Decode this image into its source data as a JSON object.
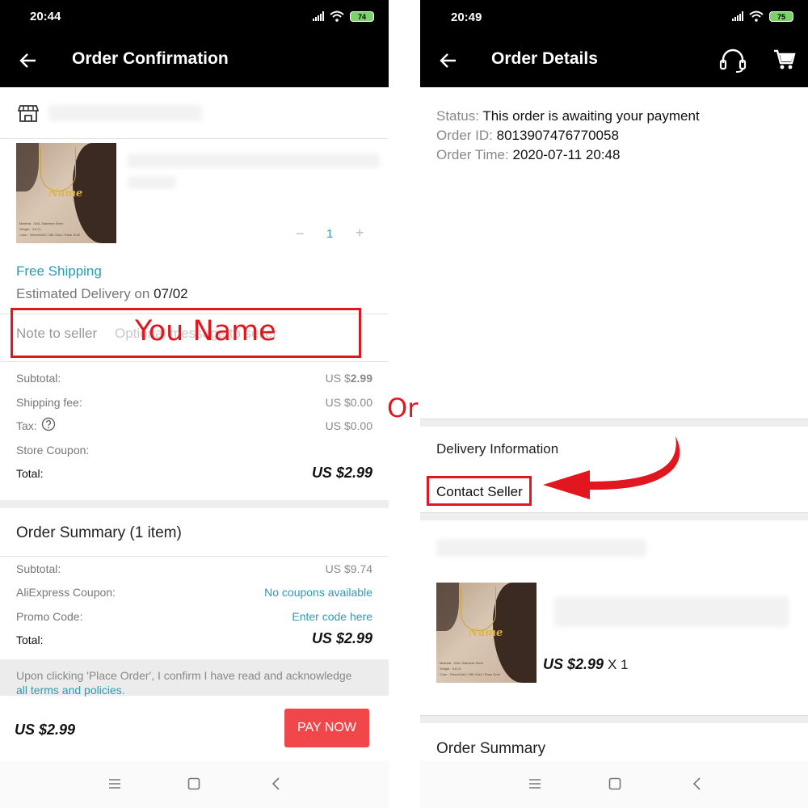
{
  "left": {
    "status_time": "20:44",
    "battery": "74",
    "title": "Order Confirmation",
    "quantity": "1",
    "free_shipping": "Free Shipping",
    "estimated_delivery_prefix": "Estimated Delivery on ",
    "estimated_delivery_date": "07/02",
    "note_label": "Note to seller",
    "note_placeholder": "Optional message to seller",
    "annotation": "You Name",
    "subtotal_label": "Subtotal:",
    "subtotal_prefix": "US $",
    "subtotal_value": "2.99",
    "shipping_label": "Shipping fee:",
    "shipping_value": "US $0.00",
    "tax_label": "Tax:",
    "tax_value": "US $0.00",
    "store_coupon_label": "Store Coupon:",
    "total_label": "Total:",
    "total_value": "US $2.99",
    "summary_title": "Order Summary (1 item)",
    "summary_subtotal_label": "Subtotal:",
    "summary_subtotal_value": "US $9.74",
    "coupon_label": "AliExpress Coupon:",
    "coupon_value": "No coupons available",
    "promo_label": "Promo Code:",
    "promo_value": "Enter code here",
    "summary_total_label": "Total:",
    "summary_total_value": "US $2.99",
    "terms_text": "Upon clicking 'Place Order', I confirm I have read and acknowledge",
    "terms_link": "all terms and policies",
    "terms_end": ".",
    "footer_total": "US $2.99",
    "pay_button": "PAY NOW"
  },
  "or_label": "Or",
  "right": {
    "status_time": "20:49",
    "battery": "75",
    "title": "Order Details",
    "status_label": "Status:",
    "status_value": "This order is awaiting your payment",
    "order_id_label": "Order ID:",
    "order_id_value": "8013907476770058",
    "order_time_label": "Order Time:",
    "order_time_value": "2020-07-11 20:48",
    "delivery_info": "Delivery Information",
    "contact_seller": "Contact Seller",
    "item_price": "US $2.99",
    "item_qty": "X 1",
    "order_summary": "Order Summary"
  },
  "colors": {
    "accent_blue": "#2b9bb3",
    "pay_button": "#f2474a",
    "annotation_red": "#e2161e",
    "bar_background": "#000000"
  },
  "icons": [
    "back-arrow-icon",
    "store-icon",
    "minus-icon",
    "plus-icon",
    "question-icon",
    "headset-icon",
    "cart-icon",
    "menu-icon",
    "home-icon",
    "nav-back-icon",
    "signal-icon",
    "wifi-icon",
    "battery-icon"
  ]
}
